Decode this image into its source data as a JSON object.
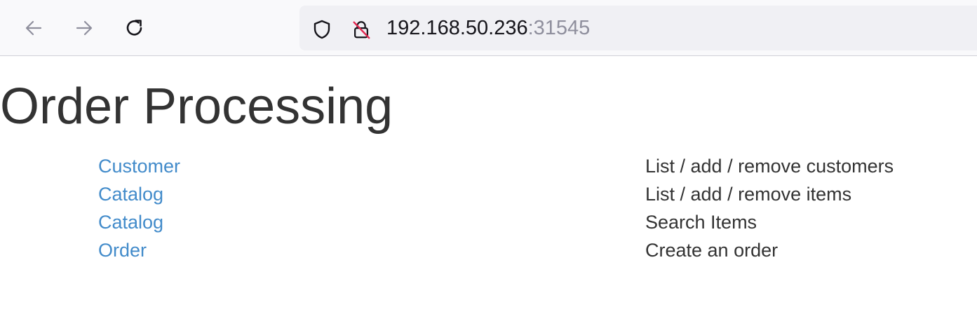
{
  "browser": {
    "url_host": "192.168.50.236",
    "url_port": ":31545",
    "icons": {
      "back": "arrow-left-icon",
      "forward": "arrow-right-icon",
      "reload": "reload-icon",
      "tracking": "shield-icon",
      "security": "insecure-lock-icon"
    }
  },
  "page": {
    "title": "Order Processing",
    "rows": [
      {
        "link": "Customer",
        "description": "List / add / remove customers"
      },
      {
        "link": "Catalog",
        "description": "List / add / remove items"
      },
      {
        "link": "Catalog",
        "description": "Search Items"
      },
      {
        "link": "Order",
        "description": "Create an order"
      }
    ]
  },
  "colors": {
    "link": "#428bca",
    "text": "#333333",
    "port": "#8f8f9d"
  }
}
